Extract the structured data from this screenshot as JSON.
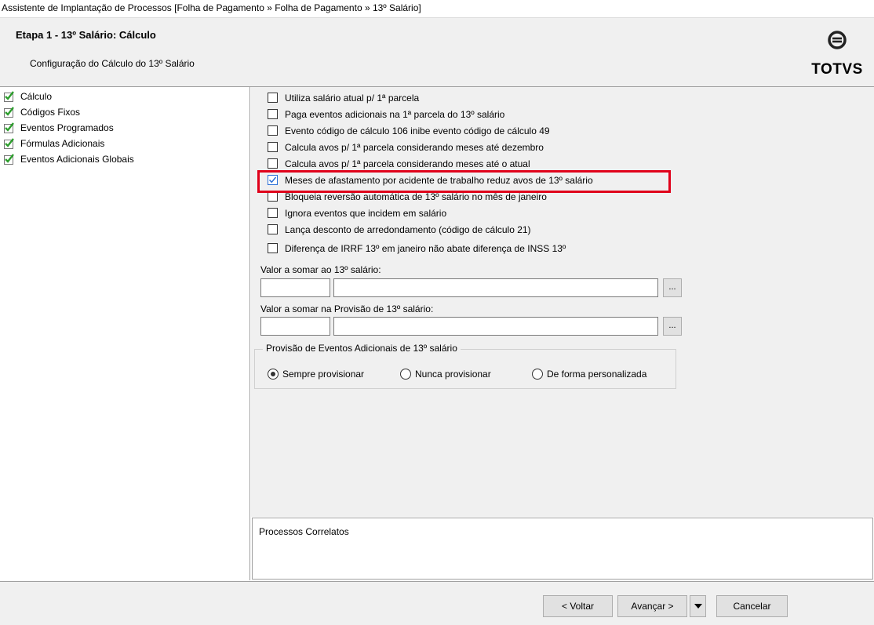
{
  "window": {
    "title": "Assistente de Implantação de Processos [Folha de Pagamento » Folha de Pagamento » 13º Salário]"
  },
  "header": {
    "step_title": "Etapa 1 - 13º Salário: Cálculo",
    "subtitle": "Configuração do Cálculo do 13º Salário",
    "logo_text": "TOTVS"
  },
  "tree": {
    "items": [
      {
        "label": "Cálculo",
        "icon": "green-check-icon"
      },
      {
        "label": "Códigos Fixos",
        "icon": "green-check-icon"
      },
      {
        "label": "Eventos Programados",
        "icon": "green-check-icon"
      },
      {
        "label": "Fórmulas Adicionais",
        "icon": "green-check-icon"
      },
      {
        "label": "Eventos Adicionais Globais",
        "icon": "green-check-icon"
      }
    ]
  },
  "options": [
    {
      "label": "Utiliza salário atual p/ 1ª parcela",
      "checked": false
    },
    {
      "label": "Paga eventos adicionais na 1ª parcela do 13º salário",
      "checked": false
    },
    {
      "label": "Evento código de cálculo 106 inibe evento código de cálculo 49",
      "checked": false
    },
    {
      "label": "Calcula avos p/ 1ª parcela considerando meses até dezembro",
      "checked": false
    },
    {
      "label": "Calcula avos p/ 1ª parcela considerando meses até o atual",
      "checked": false
    },
    {
      "label": "Meses de afastamento por acidente de trabalho reduz avos de 13º salário",
      "checked": true
    },
    {
      "label": "Bloqueia reversão automática de 13º salário no mês de janeiro",
      "checked": false
    },
    {
      "label": "Ignora eventos que incidem em salário",
      "checked": false
    },
    {
      "label": "Lança desconto de arredondamento (código de cálculo 21)",
      "checked": false
    },
    {
      "label": "Diferença de IRRF 13º em janeiro não abate diferença de INSS 13º",
      "checked": false
    }
  ],
  "valor_somar": {
    "label": "Valor a somar ao 13º salário:",
    "code": "",
    "description": "",
    "button": "..."
  },
  "valor_provisao": {
    "label": "Valor a somar na Provisão de 13º salário:",
    "code": "",
    "description": "",
    "button": "..."
  },
  "provisao_group": {
    "title": "Provisão de Eventos Adicionais de 13º salário",
    "options": [
      {
        "label": "Sempre provisionar",
        "selected": true
      },
      {
        "label": "Nunca provisionar",
        "selected": false
      },
      {
        "label": "De forma personalizada",
        "selected": false
      }
    ]
  },
  "correlatos": {
    "title": "Processos Correlatos"
  },
  "footer": {
    "back": "< Voltar",
    "next": "Avançar >",
    "cancel": "Cancelar"
  },
  "colors": {
    "highlight": "#e0001a",
    "check_green": "#2e9e2e",
    "checkbox_blue": "#2a6fd6"
  }
}
